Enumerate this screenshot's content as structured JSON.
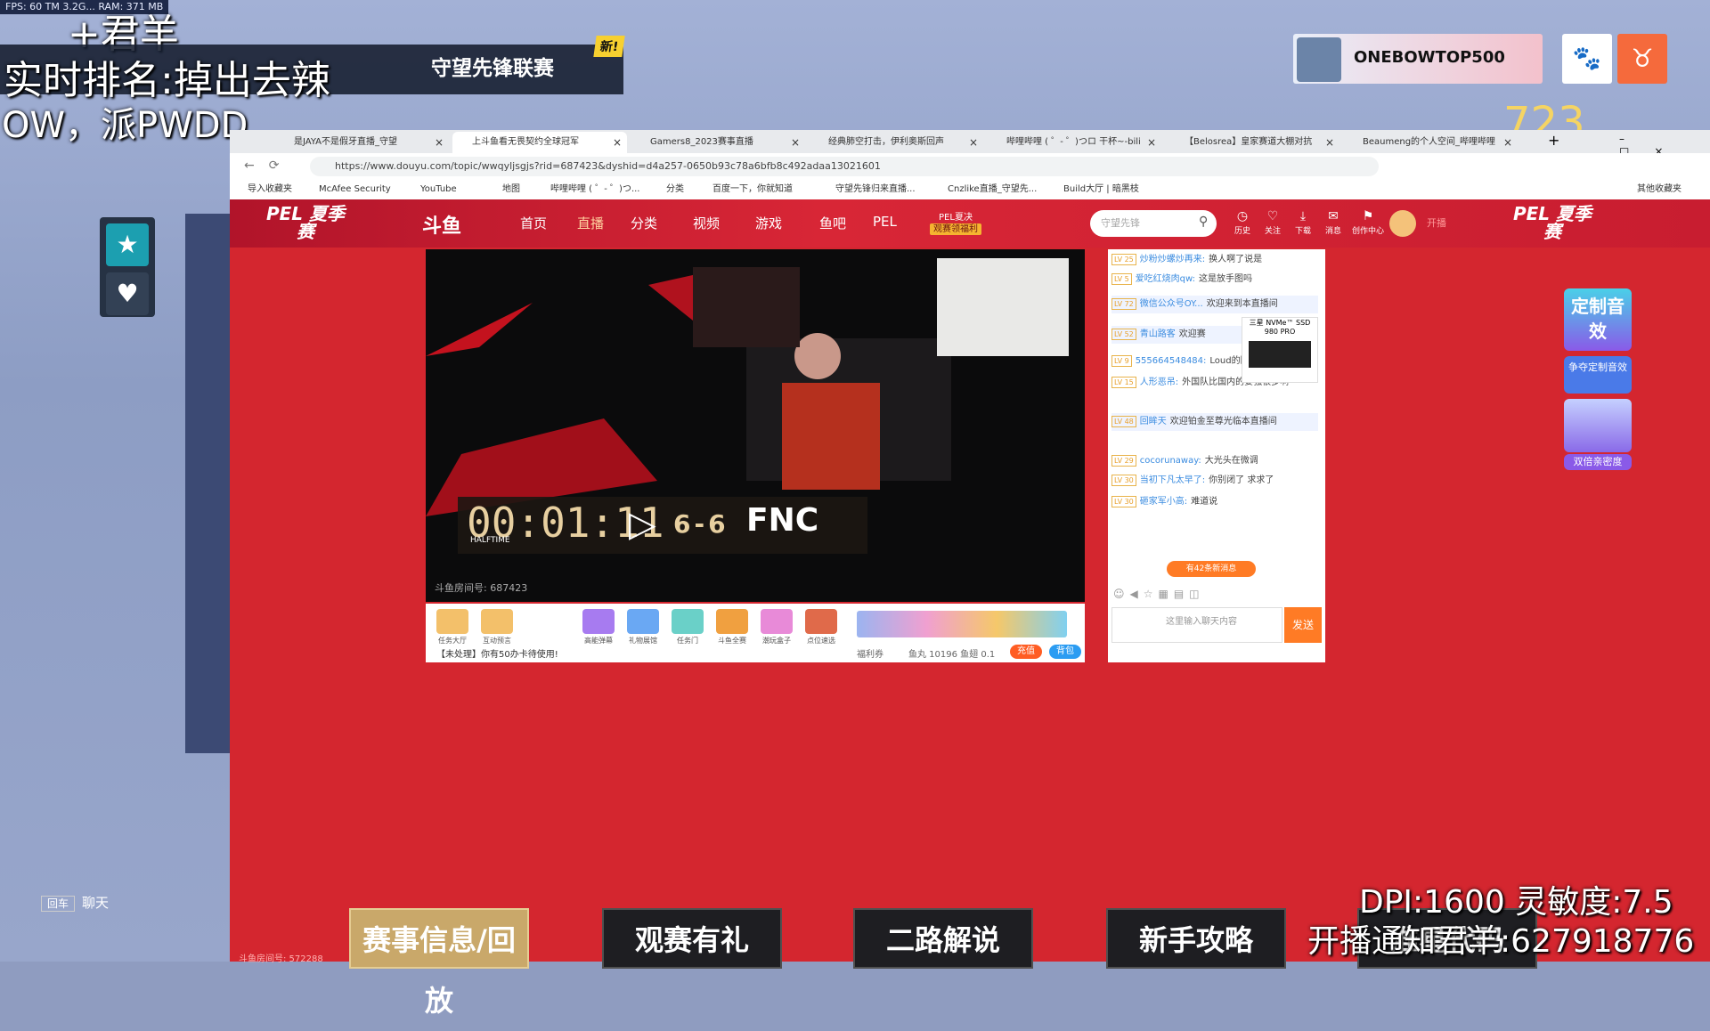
{
  "overlay": {
    "fps": "FPS: 60 TM 3.2G... RAM: 371 MB",
    "streamer": "+君羊",
    "rank_text": "实时排名:掉出去辣",
    "owl_title": "守望先锋联赛",
    "new_badge": "新!",
    "ow_text": "OW，派PWDD",
    "chat_label_badge": "回车",
    "chat_label": "聊天",
    "top_user": "ONEBOWTOP500",
    "counter": "723",
    "dpi_text": "DPI:1600 灵敏度:7.5",
    "notify_text": "开播通知君羊:627918776"
  },
  "browser": {
    "tabs": [
      {
        "label": "是JAYA不是假牙直播_守望",
        "active": false
      },
      {
        "label": "上斗鱼看无畏契约全球冠军",
        "active": true
      },
      {
        "label": "Gamers8_2023赛事直播",
        "active": false
      },
      {
        "label": "经典肺空打击，伊利奥斯回声",
        "active": false
      },
      {
        "label": "哔哩哔哩 ( ゜- ゜)つロ 干杯~-bili",
        "active": false
      },
      {
        "label": "【Belosrea】皇家赛道大棚对抗",
        "active": false
      },
      {
        "label": "Beaumeng的个人空间_哔哩哔哩",
        "active": false
      }
    ],
    "url": "https://www.douyu.com/topic/wwqyljsgjs?rid=687423&dyshid=d4a257-0650b93c78a6bfb8c492adaa13021601",
    "bookmarks": [
      "导入收藏夹",
      "McAfee Security",
      "YouTube",
      "地图",
      "哔哩哔哩 ( ゜- ゜)つ...",
      "分类",
      "百度一下，你就知道",
      "守望先锋归来直播...",
      "Cnzlike直播_守望先...",
      "Build大厅 | 暗黑枝",
      "其他收藏夹"
    ]
  },
  "douyu": {
    "logo": "斗鱼",
    "pel_left": "PEL 夏季赛",
    "pel_right": "PEL 夏季赛",
    "nav": [
      "首页",
      "直播",
      "分类",
      "视频",
      "游戏",
      "鱼吧",
      "PEL"
    ],
    "nav_promo_top": "PEL夏决",
    "nav_promo_bottom": "观赛领福利",
    "search_placeholder": "守望先锋",
    "icons": [
      "历史",
      "关注",
      "下载",
      "消息",
      "创作中心"
    ],
    "live_btn": "开播"
  },
  "video": {
    "timer": "00:01:11",
    "halftime": "HALFTIME",
    "score": "6-6",
    "team": "FNC",
    "room_id": "斗鱼房间号: 687423"
  },
  "gifts": {
    "left": [
      "任务大厅",
      "互动预言"
    ],
    "mid": [
      "高能弹幕",
      "礼物展馆",
      "任务门",
      "斗鱼全赛",
      "潮玩盒子",
      "点位速选"
    ],
    "task_text": "【未处理】你有50办卡待使用!",
    "welfare": "福利券",
    "fish_info": "鱼丸 10196  鱼翅 0.1",
    "recharge": "充值",
    "backpack": "背包"
  },
  "chat": {
    "messages": [
      {
        "lv": "LV 25",
        "user": "炒粉炒螺炒再来:",
        "text": "换人啊了说是"
      },
      {
        "lv": "LV 5",
        "user": "爱吃红烧肉qw:",
        "text": "这是放手图吗"
      },
      {
        "lv": "LV 72",
        "user": "微信公众号OY...",
        "text": "欢迎来到本直播间"
      },
      {
        "lv": "LV 52",
        "user": "青山路客",
        "text": "欢迎赛"
      },
      {
        "lv": "LV 9",
        "user": "555664548484:",
        "text": "Loud的防"
      },
      {
        "lv": "LV 15",
        "user": "人形恶吊:",
        "text": "外国队比国内的要强很多啊"
      },
      {
        "lv": "LV 48",
        "user": "回眸天",
        "text": "欢迎铂金至尊光临本直播间"
      },
      {
        "lv": "LV 29",
        "user": "cocorunaway:",
        "text": "大光头在微调"
      },
      {
        "lv": "LV 30",
        "user": "当初下凡太早了:",
        "text": "你别闭了 求求了"
      },
      {
        "lv": "LV 30",
        "user": "砸家军小高:",
        "text": "难道说"
      }
    ],
    "new_msg": "有42条新消息",
    "input_placeholder": "这里输入聊天内容",
    "send": "发送",
    "ssd_ad": "三星 NVMe™ SSD 980 PRO"
  },
  "right_promo": {
    "top": "定制音效",
    "mid": "争夺定制音效",
    "bottom": "双倍亲密度"
  },
  "bottom_buttons": [
    "赛事信息/回放",
    "观赛有礼",
    "二路解说",
    "新手攻略",
    "准星代码"
  ],
  "bottom_room": "斗鱼房间号: 572288"
}
